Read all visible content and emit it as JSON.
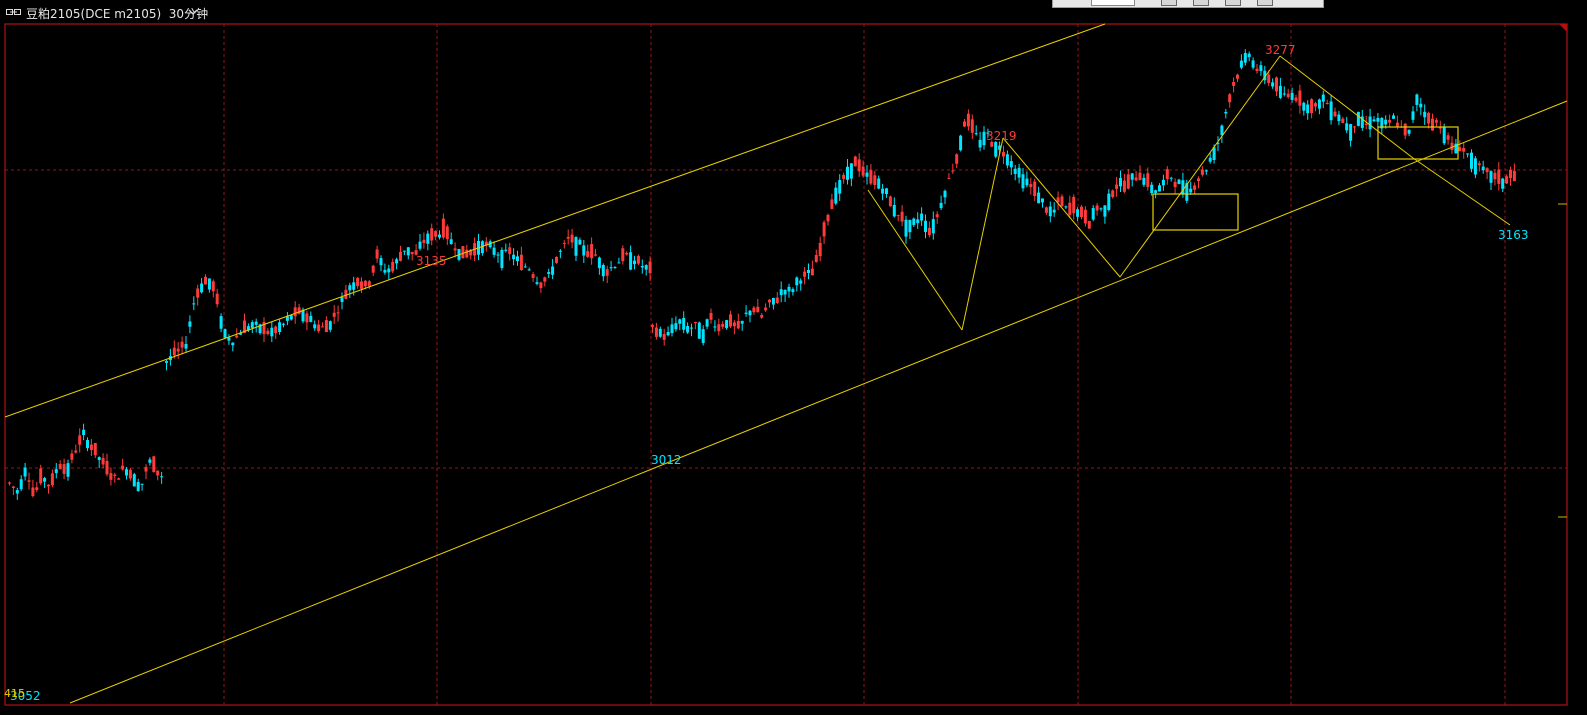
{
  "window": {
    "title": "豆粕2105(DCE m2105)",
    "timeframe": "30分钟",
    "icon": "link-icon"
  },
  "toolbar": {
    "icons": [
      "field",
      "button",
      "button",
      "button",
      "button"
    ]
  },
  "colors": {
    "background": "#000000",
    "frame": "#b01010",
    "grid": "#8a1a1a",
    "up": "#ff3a3a",
    "down": "#00e5ff",
    "annotation": "#e6d000",
    "label_high": "#ff3a3a",
    "label_low": "#00e5ff"
  },
  "chart_data": {
    "type": "candlestick",
    "title": "豆粕2105(DCE m2105)",
    "interval": "30分钟",
    "ylim": [
      2955,
      3290
    ],
    "grid": true,
    "price_labels": [
      {
        "text": "3052",
        "price": 3052,
        "kind": "low"
      },
      {
        "text": "3135",
        "price": 3135,
        "kind": "high"
      },
      {
        "text": "3012",
        "price": 3012,
        "kind": "low"
      },
      {
        "text": "3219",
        "price": 3219,
        "kind": "high"
      },
      {
        "text": "3277",
        "price": 3277,
        "kind": "high"
      },
      {
        "text": "3163",
        "price": 3163,
        "kind": "low"
      }
    ],
    "corner_label": "415",
    "price_path": [
      [
        3064,
        3060,
        3072,
        3058,
        3068,
        3062,
        3074,
        3070,
        3080,
        3088,
        3082,
        3076,
        3070,
        3066,
        3072,
        3068,
        3062,
        3075,
        3070,
        3066
      ],
      [
        3124,
        3128,
        3132,
        3156,
        3164,
        3160,
        3138,
        3134,
        3140,
        3142,
        3140,
        3138,
        3141,
        3146,
        3148,
        3145,
        3140,
        3142,
        3150,
        3160,
        3164,
        3160,
        3176,
        3168,
        3172,
        3180,
        3176,
        3184,
        3186,
        3188,
        3182,
        3176,
        3178,
        3182,
        3180,
        3176,
        3178,
        3172,
        3170,
        3162,
        3166,
        3176,
        3184,
        3182,
        3178,
        3176,
        3168,
        3172,
        3176,
        3174,
        3170,
        3168
      ],
      [
        3140,
        3138,
        3136,
        3142,
        3144,
        3140,
        3142,
        3138,
        3146,
        3140,
        3144,
        3142,
        3140,
        3148,
        3150,
        3146,
        3152,
        3154,
        3160,
        3158,
        3164,
        3166,
        3168,
        3178,
        3194,
        3206,
        3212,
        3218,
        3222,
        3216,
        3214,
        3212,
        3208,
        3200,
        3196,
        3190,
        3192,
        3196,
        3188,
        3194,
        3206,
        3216,
        3226,
        3244,
        3238,
        3232,
        3236,
        3230,
        3228,
        3224,
        3218,
        3214,
        3210,
        3206,
        3200,
        3196,
        3204,
        3198,
        3200,
        3196,
        3192,
        3200,
        3198,
        3206,
        3212,
        3210,
        3214,
        3216,
        3212,
        3208,
        3210,
        3216,
        3212,
        3210,
        3208,
        3214,
        3218,
        3226,
        3234,
        3250,
        3262,
        3270,
        3276,
        3268,
        3266,
        3262,
        3258,
        3254,
        3256,
        3252,
        3250,
        3248,
        3254,
        3250,
        3246,
        3242,
        3238,
        3244,
        3240,
        3244,
        3242,
        3240,
        3244,
        3238,
        3236,
        3254,
        3248,
        3240,
        3242,
        3236,
        3228,
        3230,
        3226,
        3222,
        3218,
        3216,
        3214,
        3212,
        3216,
        3214
      ]
    ]
  }
}
